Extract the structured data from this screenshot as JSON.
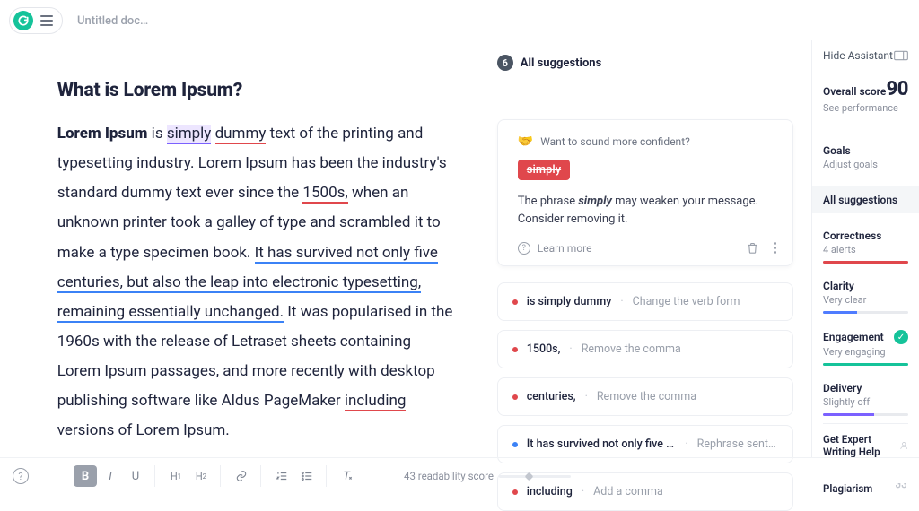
{
  "header": {
    "doc_title": "Untitled doc…"
  },
  "editor": {
    "heading": "What is Lorem Ipsum?"
  },
  "suggestions": {
    "count": "6",
    "header": "All suggestions",
    "active": {
      "category_text": "Want to sound more confident?",
      "chip": "simply",
      "advice_prefix": "The phrase ",
      "advice_em": "simply",
      "advice_suffix": " may weaken your message. Consider removing it.",
      "learn": "Learn more"
    },
    "rows": [
      {
        "color": "red",
        "text": "is simply dummy",
        "hint": "Change the verb form"
      },
      {
        "color": "red",
        "text": "1500s,",
        "hint": "Remove the comma"
      },
      {
        "color": "red",
        "text": "centuries,",
        "hint": "Remove the comma"
      },
      {
        "color": "blue",
        "text": "It has survived not only five centu…",
        "hint": "Rephrase sentence"
      },
      {
        "color": "red",
        "text": "including",
        "hint": "Add a comma"
      }
    ]
  },
  "sidebar": {
    "hide": "Hide Assistant",
    "overall_label": "Overall score",
    "overall_score": "90",
    "see_perf": "See performance",
    "goals_title": "Goals",
    "goals_sub": "Adjust goals",
    "all_sug": "All suggestions",
    "metrics": {
      "correctness": {
        "title": "Correctness",
        "sub": "4 alerts",
        "color": "#e0474c",
        "pct": 100
      },
      "clarity": {
        "title": "Clarity",
        "sub": "Very clear",
        "color": "#4f7cff",
        "pct": 40
      },
      "engagement": {
        "title": "Engagement",
        "sub": "Very engaging",
        "color": "#15c39a",
        "pct": 100,
        "ok": true
      },
      "delivery": {
        "title": "Delivery",
        "sub": "Slightly off",
        "color": "#7b61ff",
        "pct": 60
      }
    },
    "expert": "Get Expert Writing Help",
    "plagiarism": "Plagiarism"
  },
  "bottombar": {
    "readability": "43 readability score"
  }
}
